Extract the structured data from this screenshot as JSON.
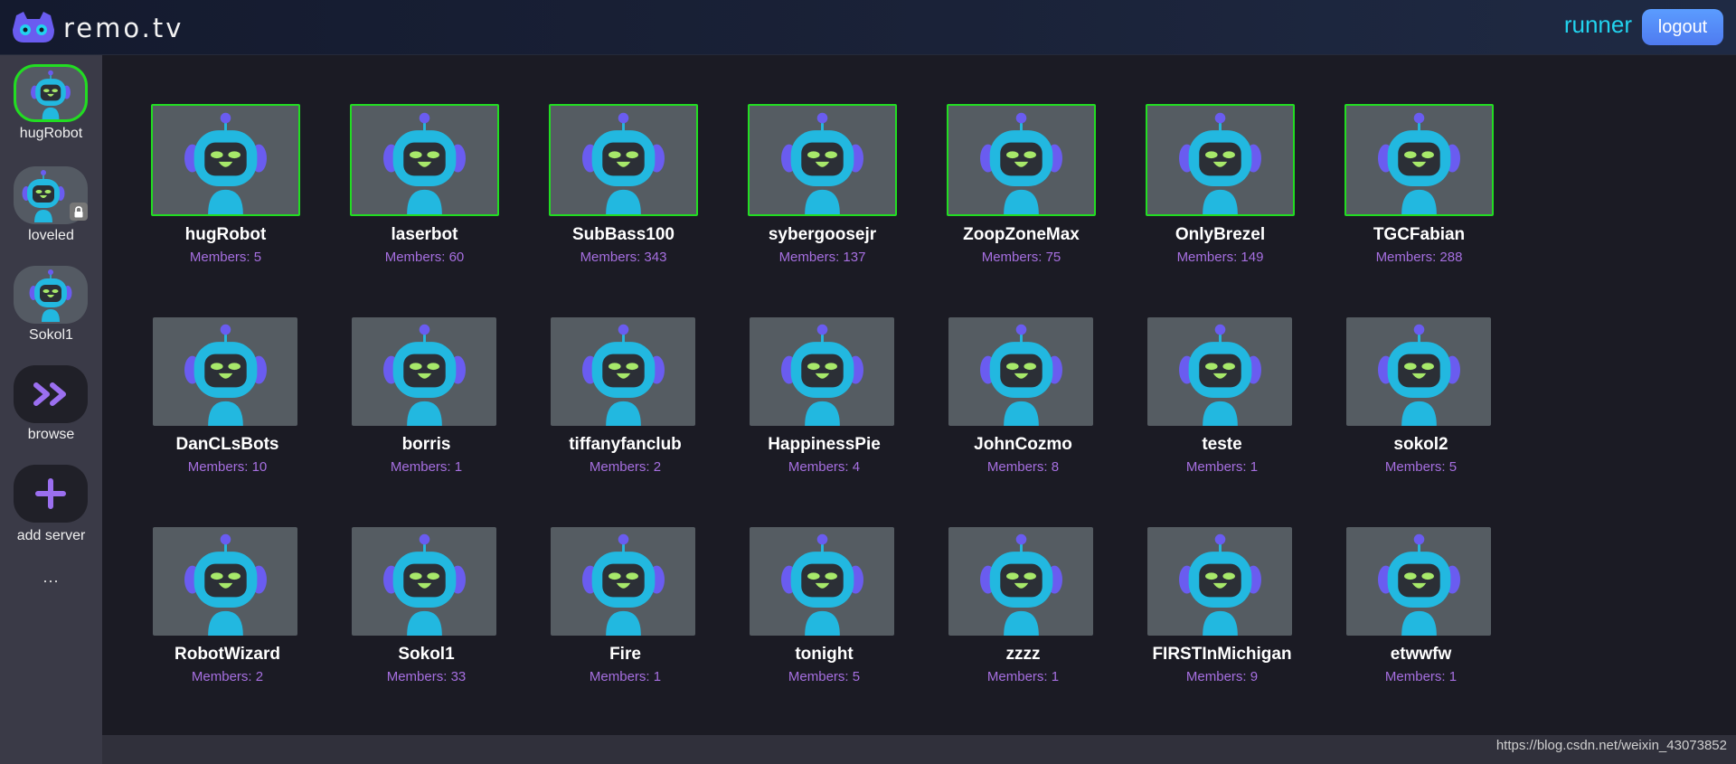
{
  "header": {
    "logo_text": "remo.tv",
    "user_name": "runner",
    "logout_label": "logout"
  },
  "sidebar": {
    "items": [
      {
        "label": "hugRobot",
        "icon": "robot-avatar-icon",
        "active": true
      },
      {
        "label": "loveled",
        "icon": "robot-avatar-icon",
        "locked": true
      },
      {
        "label": "Sokol1",
        "icon": "robot-avatar-icon"
      },
      {
        "label": "browse",
        "icon": "chevrons-right-icon"
      },
      {
        "label": "add server",
        "icon": "plus-icon"
      }
    ],
    "more_label": "..."
  },
  "robots": [
    {
      "name": "hugRobot",
      "members": "Members: 5",
      "active": true
    },
    {
      "name": "laserbot",
      "members": "Members: 60",
      "active": true
    },
    {
      "name": "SubBass100",
      "members": "Members: 343",
      "active": true
    },
    {
      "name": "sybergoosejr",
      "members": "Members: 137",
      "active": true
    },
    {
      "name": "ZoopZoneMax",
      "members": "Members: 75",
      "active": true
    },
    {
      "name": "OnlyBrezel",
      "members": "Members: 149",
      "active": true
    },
    {
      "name": "TGCFabian",
      "members": "Members: 288",
      "active": true
    },
    {
      "name": "DanCLsBots",
      "members": "Members: 10"
    },
    {
      "name": "borris",
      "members": "Members: 1"
    },
    {
      "name": "tiffanyfanclub",
      "members": "Members: 2"
    },
    {
      "name": "HappinessPie",
      "members": "Members: 4"
    },
    {
      "name": "JohnCozmo",
      "members": "Members: 8"
    },
    {
      "name": "teste",
      "members": "Members: 1"
    },
    {
      "name": "sokol2",
      "members": "Members: 5"
    },
    {
      "name": "RobotWizard",
      "members": "Members: 2"
    },
    {
      "name": "Sokol1",
      "members": "Members: 33"
    },
    {
      "name": "Fire",
      "members": "Members: 1"
    },
    {
      "name": "tonight",
      "members": "Members: 5"
    },
    {
      "name": "zzzz",
      "members": "Members: 1"
    },
    {
      "name": "FIRSTInMichigan",
      "members": "Members: 9"
    },
    {
      "name": "etwwfw",
      "members": "Members: 1"
    }
  ],
  "watermark": "https://blog.csdn.net/weixin_43073852",
  "colors": {
    "accent_cyan": "#22d3ee",
    "active_border": "#22dd22",
    "members_purple": "#a66fe0",
    "logout_blue": "#4f7bf0"
  }
}
